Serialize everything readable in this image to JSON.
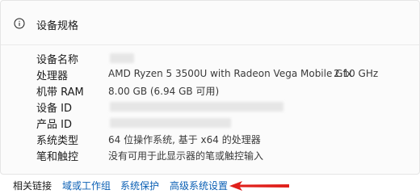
{
  "section": {
    "title": "设备规格"
  },
  "specs": [
    {
      "label": "设备名称",
      "value": "",
      "extra": ""
    },
    {
      "label": "处理器",
      "value": "AMD Ryzen 5 3500U with Radeon Vega Mobile Gfx",
      "extra": "2.10 GHz"
    },
    {
      "label": "机带 RAM",
      "value": "8.00 GB (6.94 GB 可用)",
      "extra": ""
    },
    {
      "label": "设备 ID",
      "value": "",
      "extra": ""
    },
    {
      "label": "产品 ID",
      "value": "",
      "extra": ""
    },
    {
      "label": "系统类型",
      "value": "64 位操作系统, 基于 x64 的处理器",
      "extra": ""
    },
    {
      "label": "笔和触控",
      "value": "没有可用于此显示器的笔或触控输入",
      "extra": ""
    }
  ],
  "related": {
    "label": "相关链接",
    "links": [
      "域或工作组",
      "系统保护",
      "高级系统设置"
    ]
  },
  "colors": {
    "link": "#0a5fb4",
    "arrow": "#e0201b"
  },
  "icons": {
    "info": "info-circle-icon",
    "annotation": "red-arrow-annotation"
  }
}
